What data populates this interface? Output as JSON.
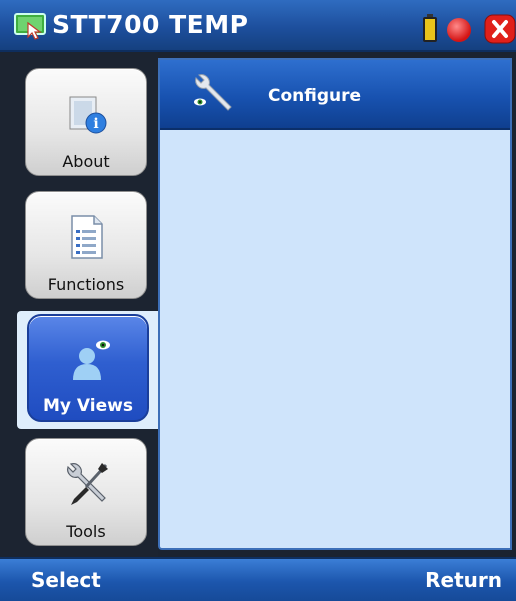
{
  "titlebar": {
    "title": "STT700 TEMP",
    "icons": [
      "app-monitor-icon",
      "battery-icon",
      "record-icon",
      "close-icon"
    ],
    "colors": {
      "bar": "#1d4f9d",
      "close": "#e0201a",
      "battery": "#e9c41a"
    }
  },
  "sidebar": {
    "items": [
      {
        "label": "About",
        "icon": "info-document-icon",
        "selected": false
      },
      {
        "label": "Functions",
        "icon": "list-document-icon",
        "selected": false
      },
      {
        "label": "My Views",
        "icon": "user-view-icon",
        "selected": true
      },
      {
        "label": "Tools",
        "icon": "wrench-screwdriver-icon",
        "selected": false
      }
    ]
  },
  "content": {
    "items": [
      {
        "label": "Configure",
        "icon": "wrench-eye-icon",
        "selected": true
      }
    ],
    "background": "#cfe4fb"
  },
  "softkeys": {
    "left": "Select",
    "right": "Return"
  }
}
